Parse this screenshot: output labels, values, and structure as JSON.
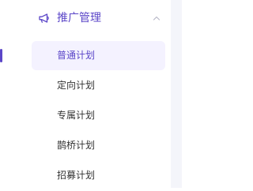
{
  "accent_color": "#5b46c8",
  "menu": {
    "section": {
      "icon": "megaphone-icon",
      "label": "推广管理",
      "expanded": true,
      "chevron_icon": "chevron-up-icon"
    },
    "items": [
      {
        "label": "普通计划",
        "active": true
      },
      {
        "label": "定向计划",
        "active": false
      },
      {
        "label": "专属计划",
        "active": false
      },
      {
        "label": "鹊桥计划",
        "active": false
      },
      {
        "label": "招募计划",
        "active": false
      }
    ]
  }
}
